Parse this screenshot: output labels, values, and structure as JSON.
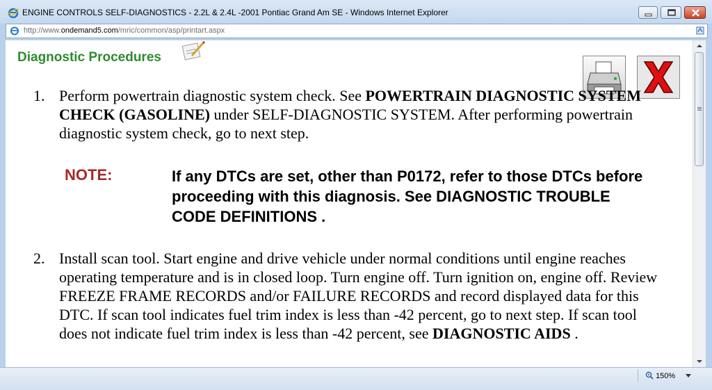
{
  "window": {
    "title": "ENGINE CONTROLS SELF-DIAGNOSTICS - 2.2L & 2.4L -2001 Pontiac Grand Am SE - Windows Internet Explorer",
    "icon": "ie-icon",
    "controls": [
      "minimize-icon",
      "maximize-icon",
      "close-icon"
    ]
  },
  "address": {
    "prefix": "http://www.",
    "domain": "ondemand5.com",
    "path": "/mric/common/asp/printart.aspx"
  },
  "page": {
    "heading": "Diagnostic Procedures",
    "print_icon": "printer-icon",
    "close_icon": "red-x-icon",
    "steps": [
      {
        "num": "1.",
        "text_a": "Perform powertrain diagnostic system check. See ",
        "bold_a": "POWERTRAIN DIAGNOSTIC SYSTEM CHECK (GASOLINE)",
        "text_b": " under SELF-DIAGNOSTIC SYSTEM. After performing powertrain diagnostic system check, go to next step."
      },
      {
        "num": "2.",
        "text_a": "Install scan tool. Start engine and drive vehicle under normal conditions until engine reaches operating temperature and is in closed loop. Turn engine off. Turn ignition on, engine off. Review FREEZE FRAME RECORDS and/or FAILURE RECORDS and record displayed data for this DTC. If scan tool indicates fuel trim index is less than -42 percent, go to next step. If scan tool does not indicate fuel trim index is less than -42 percent, see ",
        "bold_a": "DIAGNOSTIC AIDS",
        "text_b": " ."
      }
    ],
    "note": {
      "label": "NOTE:",
      "text": "If any DTCs are set, other than P0172, refer to those DTCs before proceeding with this diagnosis. See DIAGNOSTIC TROUBLE CODE DEFINITIONS ."
    }
  },
  "status": {
    "zoom": "150%"
  },
  "colors": {
    "heading": "#2e8b2e",
    "note_label": "#a52a2a",
    "close_x": "#e01010"
  }
}
